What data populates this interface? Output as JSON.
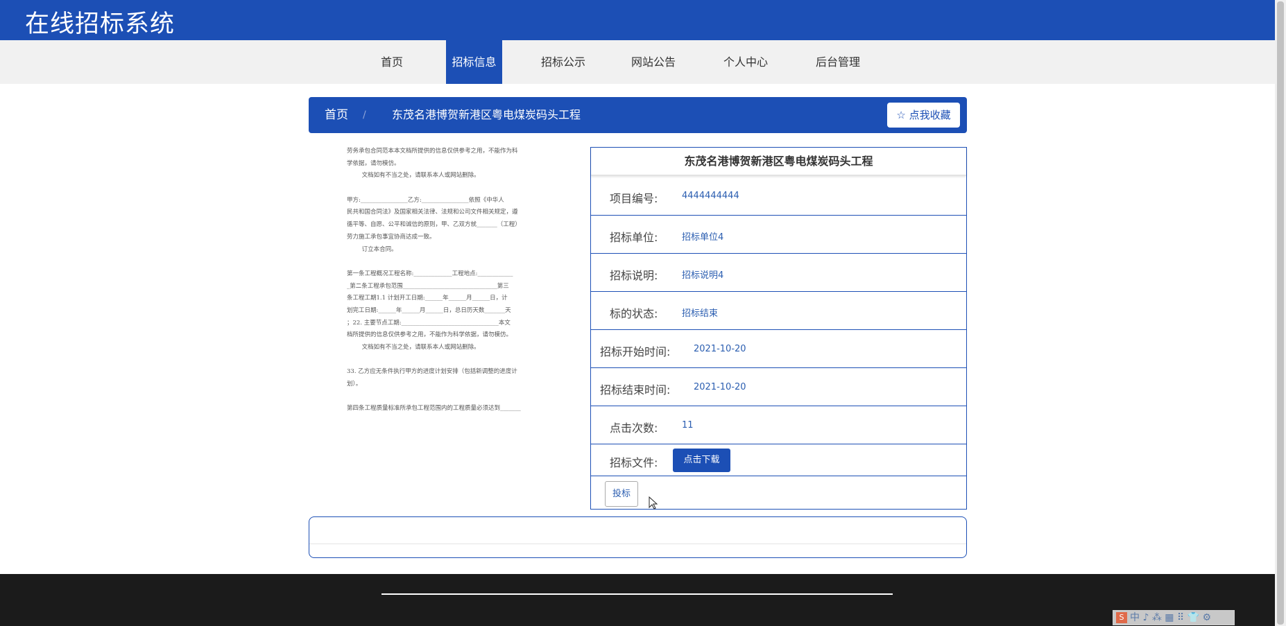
{
  "header": {
    "site_title": "在线招标系统"
  },
  "nav": {
    "items": [
      {
        "label": "首页",
        "active": false
      },
      {
        "label": "招标信息",
        "active": true
      },
      {
        "label": "招标公示",
        "active": false
      },
      {
        "label": "网站公告",
        "active": false
      },
      {
        "label": "个人中心",
        "active": false
      },
      {
        "label": "后台管理",
        "active": false
      }
    ]
  },
  "breadcrumb": {
    "home": "首页",
    "separator": "/",
    "current": "东茂名港博贺新港区粤电煤炭码头工程",
    "favorite_button": "☆ 点我收藏"
  },
  "document_preview": {
    "lines": [
      "劳务承包合同范本本文档所提供的信息仅供参考之用，不能作为科",
      "学依据，请勿模仿。",
      "        文档如有不当之处，请联系本人或网站删除。",
      "",
      "甲方:________________乙方:________________依照《中华人",
      "民共和国合同法》及国家相关法律、法规和公司文件相关规定，遵",
      "循平等、自愿、公平和诚信的原则，甲、乙双方就_______（工程）",
      "劳力施工承包事宜协商达成一致。",
      "        订立本合同。",
      "",
      "第一条工程概况工程名称:_____________工程地点:____________",
      "_第二条工程承包范围________________________________第三",
      "条工程工期1.1 计划开工日期:______年______月______日，计",
      "划完工日期:______年______月______日，总日历天数_______天",
      "；22. 主要节点工期:_________________________________本文",
      "档所提供的信息仅供参考之用，不能作为科学依据，请勿模仿。",
      "        文档如有不当之处，请联系本人或网站删除。",
      "",
      "33. 乙方应无条件执行甲方的进度计划安排（包括新调整的进度计",
      "划）。",
      "",
      "第四条工程质量标准所承包工程范围内的工程质量必须达到_______"
    ]
  },
  "info_card": {
    "title": "东茂名港博贺新港区粤电煤炭码头工程",
    "rows": [
      {
        "label": "项目编号:",
        "value": "4444444444"
      },
      {
        "label": "招标单位:",
        "value": "招标单位4"
      },
      {
        "label": "招标说明:",
        "value": "招标说明4"
      },
      {
        "label": "标的状态:",
        "value": "招标结束"
      },
      {
        "label": "招标开始时间:",
        "value": "2021-10-20"
      },
      {
        "label": "招标结束时间:",
        "value": "2021-10-20"
      },
      {
        "label": "点击次数:",
        "value": "11"
      }
    ],
    "file_label": "招标文件:",
    "download_button": "点击下载",
    "bid_button": "投标"
  },
  "ime_toolbar": {
    "logo": "S",
    "text": "中 ♪ ⁂ ▦ ⠿ 👕 ⚙"
  }
}
